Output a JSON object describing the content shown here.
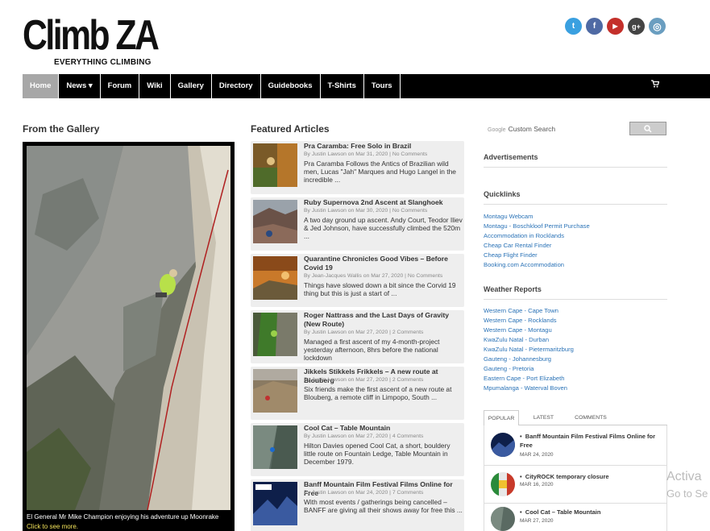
{
  "header": {
    "logo_main": "Climb ZA",
    "logo_sub": "EVERYTHING CLIMBING",
    "social": [
      {
        "name": "twitter-icon",
        "glyph": "t",
        "color": "#3aa0e0"
      },
      {
        "name": "facebook-icon",
        "glyph": "f",
        "color": "#4f6aa4"
      },
      {
        "name": "youtube-icon",
        "glyph": "▶",
        "color": "#c4302b"
      },
      {
        "name": "googleplus-icon",
        "glyph": "g+",
        "color": "#444444"
      },
      {
        "name": "instagram-icon",
        "glyph": "◎",
        "color": "#6a9ec0"
      }
    ]
  },
  "nav": {
    "items": [
      "Home",
      "News ▾",
      "Forum",
      "Wiki",
      "Gallery",
      "Directory",
      "Guidebooks",
      "T-Shirts",
      "Tours"
    ],
    "cart_icon": "cart-icon"
  },
  "gallery": {
    "title": "From the Gallery",
    "caption": "El General Mr Mike Champion enjoying his adventure up Moonrake",
    "caption_link": "Click to see more."
  },
  "featured": {
    "title": "Featured Articles",
    "articles": [
      {
        "title": "Pra Caramba: Free Solo in Brazil",
        "by": "By Justin Lawson on Mar 31, 2020 | ",
        "comments": "No Comments",
        "excerpt": "Pra Caramba Follows the Antics of Brazilian wild men, Lucas \"Jah\" Marques and Hugo Langel in the incredible ..."
      },
      {
        "title": "Ruby Supernova 2nd Ascent at Slanghoek",
        "by": "By Justin Lawson on Mar 30, 2020 | ",
        "comments": "No Comments",
        "excerpt": "A two day ground up ascent. Andy Court, Teodor Iliev & Jed Johnson, have successfully climbed the 520m ..."
      },
      {
        "title": "Quarantine Chronicles Good Vibes – Before Covid 19",
        "by": "By Jean-Jacques Wallis on Mar 27, 2020 | ",
        "comments": "No Comments",
        "excerpt": "Things have slowed down a bit since the Corvid 19 thing but this is just a start of ..."
      },
      {
        "title": "Roger Nattrass and the Last Days of Gravity (New Route)",
        "by": "By Justin Lawson on Mar 27, 2020 | ",
        "comments": "2 Comments",
        "excerpt": "Managed a first ascent of my 4-month-project yesterday afternoon, 8hrs before the national lockdown"
      },
      {
        "title": "Jikkels Stikkels Frikkels – A new route at Blouberg",
        "by": "By Justin Lawson on Mar 27, 2020 | ",
        "comments": "2 Comments",
        "excerpt": "Six friends make the first ascent of a new route at Blouberg, a remote cliff in Limpopo, South ..."
      },
      {
        "title": "Cool Cat – Table Mountain",
        "by": "By Justin Lawson on Mar 27, 2020 | ",
        "comments": "4 Comments",
        "excerpt": "Hilton Davies opened Cool Cat, a short, bouldery little route on Fountain Ledge, Table Mountain in December 1979."
      },
      {
        "title": "Banff Mountain Film Festival Films Online for Free",
        "by": "By Justin Lawson on Mar 24, 2020 | ",
        "comments": "7 Comments",
        "excerpt": "With most events / gatherings being cancelled – BANFF are giving all their shows away for free this ..."
      }
    ]
  },
  "sidebar": {
    "search_brand": "Google",
    "search_placeholder": "Custom Search",
    "advertisements": "Advertisements",
    "quicklinks_title": "Quicklinks",
    "quicklinks": [
      "Montagu Webcam",
      "Montagu - Boschkloof Permit Purchase",
      "Accommodation in Rocklands",
      "Cheap Car Rental Finder",
      "Cheap Flight Finder",
      "Booking.com Accommodation"
    ],
    "weather_title": "Weather Reports",
    "weather": [
      "Western Cape - Cape Town",
      "Western Cape - Rocklands",
      "Western Cape - Montagu",
      "KwaZulu Natal - Durban",
      "KwaZulu Natal - Pietermaritzburg",
      "Gauteng - Johannesburg",
      "Gauteng - Pretoria",
      "Eastern Cape - Port Elizabeth",
      "Mpumalanga - Waterval Boven"
    ],
    "tabs": [
      "POPULAR",
      "LATEST",
      "COMMENTS"
    ],
    "popular": [
      {
        "title": "Banff Mountain Film Festival Films Online for Free",
        "date": "MAR 24, 2020"
      },
      {
        "title": "CityROCK temporary closure",
        "date": "MAR 16, 2020"
      },
      {
        "title": "Cool Cat – Table Mountain",
        "date": "MAR 27, 2020"
      }
    ]
  },
  "watermark": {
    "line1": "Activa",
    "line2": "Go to Se"
  }
}
